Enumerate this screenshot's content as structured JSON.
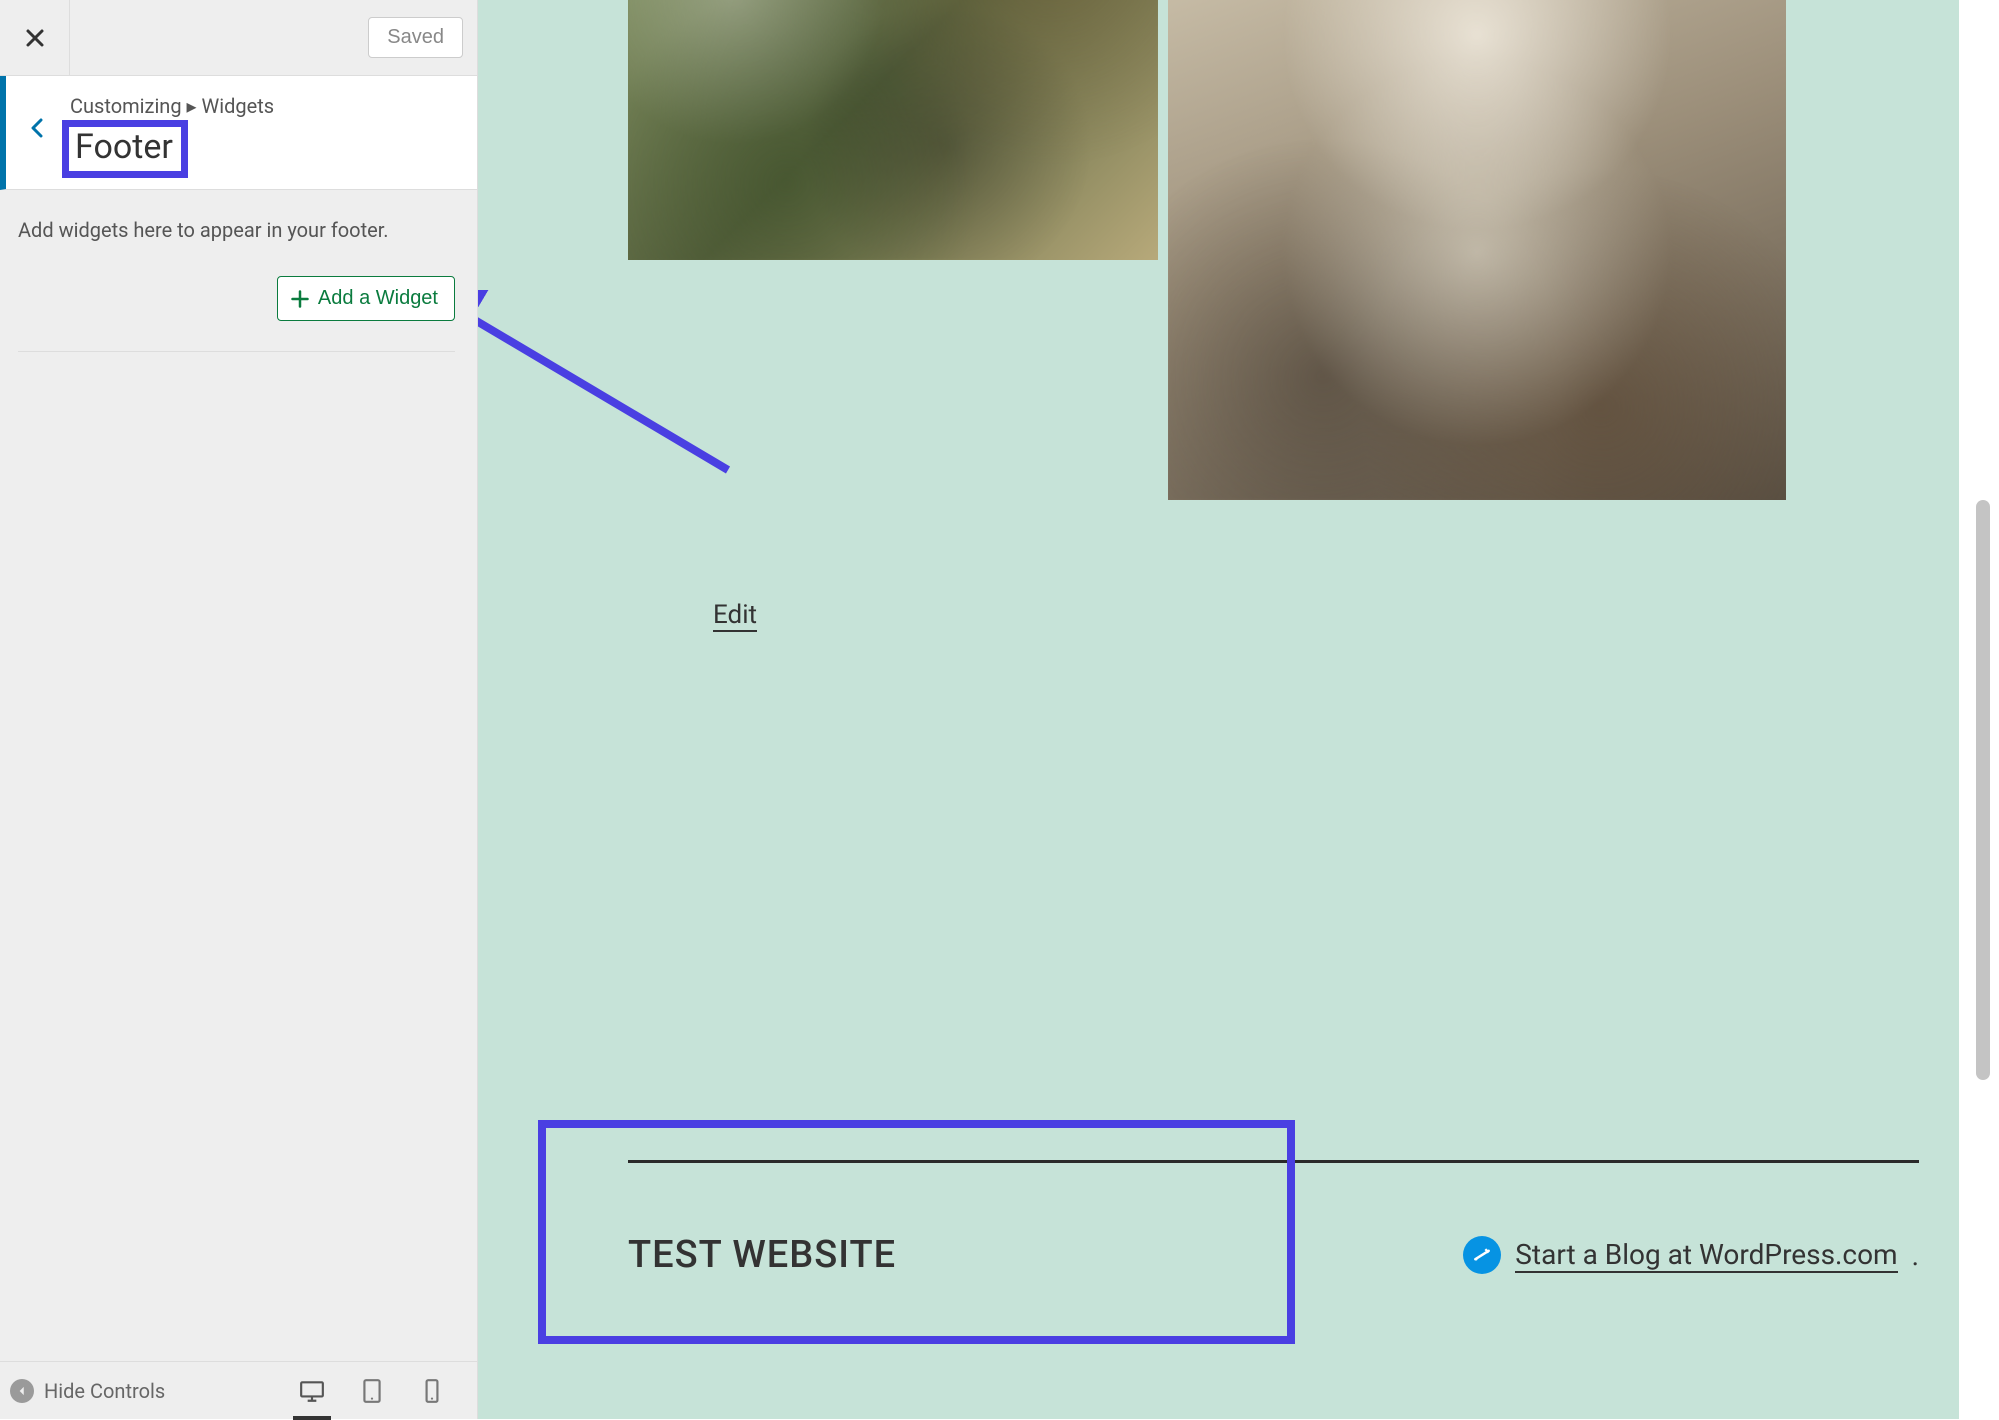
{
  "sidebar": {
    "saved_label": "Saved",
    "breadcrumb": "Customizing ▸ Widgets",
    "section_title": "Footer",
    "helper_text": "Add widgets here to appear in your footer.",
    "add_widget_label": "Add a Widget"
  },
  "bottom_bar": {
    "hide_controls_label": "Hide Controls"
  },
  "preview": {
    "edit_label": "Edit",
    "site_title": "TEST WEBSITE",
    "wp_link_text": "Start a Blog at WordPress.com",
    "wp_link_suffix": "."
  }
}
